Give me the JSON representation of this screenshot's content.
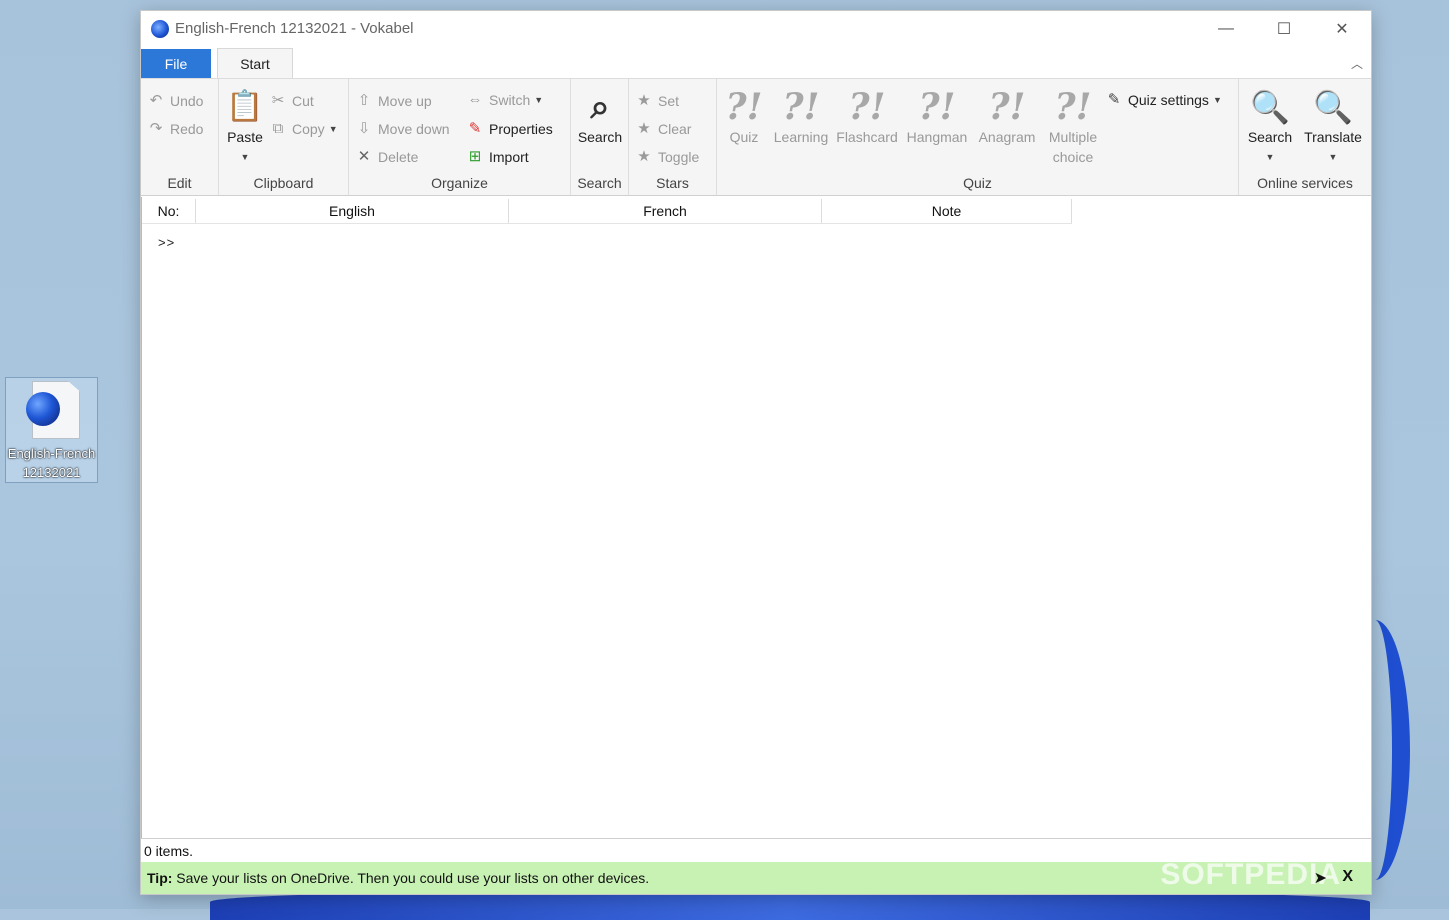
{
  "desktop": {
    "icon_label": "English-French 12132021"
  },
  "window": {
    "title": "English-French 12132021 - Vokabel",
    "minimize": "—",
    "maximize": "☐",
    "close": "✕"
  },
  "tabs": {
    "file": "File",
    "start": "Start"
  },
  "ribbon": {
    "edit": {
      "undo": "Undo",
      "redo": "Redo",
      "label": "Edit"
    },
    "clipboard": {
      "paste": "Paste",
      "cut": "Cut",
      "copy": "Copy",
      "label": "Clipboard"
    },
    "organize": {
      "move_up": "Move up",
      "move_down": "Move down",
      "delete": "Delete",
      "switch": "Switch",
      "properties": "Properties",
      "import": "Import",
      "label": "Organize"
    },
    "search": {
      "search": "Search",
      "label": "Search"
    },
    "stars": {
      "set": "Set",
      "clear": "Clear",
      "toggle": "Toggle",
      "label": "Stars"
    },
    "quiz": {
      "quiz": "Quiz",
      "learning": "Learning",
      "flashcard": "Flashcard",
      "hangman": "Hangman",
      "anagram": "Anagram",
      "multiple_line1": "Multiple",
      "multiple_line2": "choice",
      "settings": "Quiz settings",
      "label": "Quiz"
    },
    "online": {
      "search": "Search",
      "translate": "Translate",
      "label": "Online services"
    }
  },
  "grid": {
    "columns": [
      "No:",
      "English",
      "French",
      "Note"
    ],
    "new_row_marker": ">>"
  },
  "status": {
    "items": "0 items."
  },
  "tip": {
    "label": "Tip:",
    "text": "Save your lists on OneDrive. Then you could use your lists on other devices.",
    "watermark": "SOFTPEDIA",
    "close": "X"
  }
}
